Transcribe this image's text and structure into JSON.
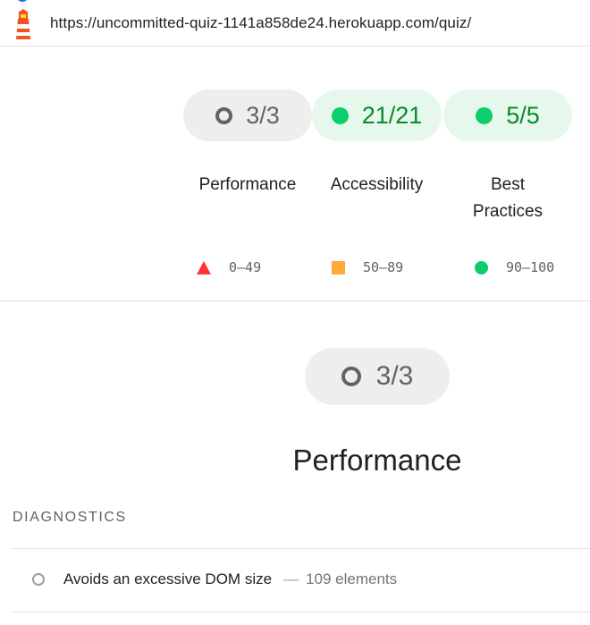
{
  "address_bar": {
    "url": "https://uncommitted-quiz-1141a858de24.herokuapp.com/quiz/",
    "site_icon": "lighthouse-icon"
  },
  "summary_gauges": [
    {
      "score": "3/3",
      "label": "Performance",
      "status": "informative",
      "icon": "ring-icon"
    },
    {
      "score": "21/21",
      "label": "Accessibility",
      "status": "pass",
      "icon": "green-dot-icon"
    },
    {
      "score": "5/5",
      "label": "Best Practices",
      "status": "pass",
      "icon": "green-dot-icon"
    }
  ],
  "scale_legend": [
    {
      "range": "0–49",
      "icon": "red-triangle-icon",
      "color": "#ff3333"
    },
    {
      "range": "50–89",
      "icon": "orange-square-icon",
      "color": "#ffaa33"
    },
    {
      "range": "90–100",
      "icon": "green-circle-icon",
      "color": "#0cce6b"
    }
  ],
  "performance_section": {
    "score": "3/3",
    "title": "Performance",
    "group_header": "DIAGNOSTICS",
    "audits": [
      {
        "title": "Avoids an excessive DOM size",
        "separator": "—",
        "display_value": "109 elements",
        "icon": "informative-circle-icon"
      }
    ]
  },
  "colors": {
    "pass_green": "#0cce6b",
    "pass_text": "#0a8a28",
    "fail_red": "#ff3333",
    "average_orange": "#ffaa33",
    "neutral_gray": "#5f6368"
  }
}
